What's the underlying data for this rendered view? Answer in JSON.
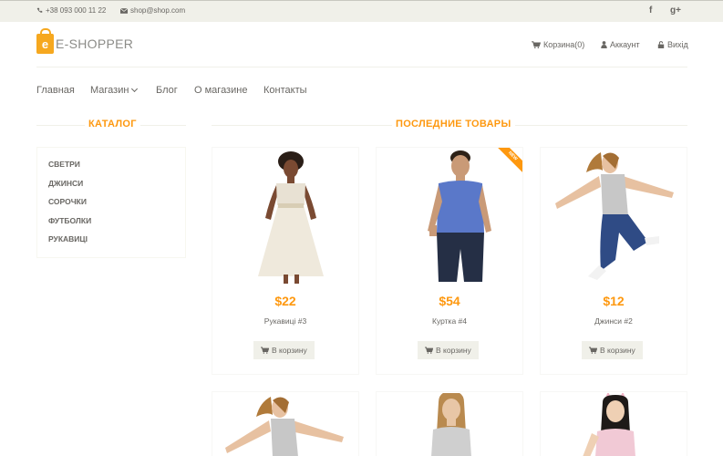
{
  "topbar": {
    "phone": "+38 093 000 11 22",
    "email": "shop@shop.com",
    "social": [
      "facebook-icon",
      "google-plus-icon"
    ],
    "facebook_glyph": "f",
    "gplus_glyph": "g+"
  },
  "logo": {
    "letter": "e",
    "brand": "E-SHOPPER"
  },
  "header_links": {
    "cart": "Корзина(0)",
    "account": "Аккаунт",
    "logout": "Вихід"
  },
  "nav": {
    "home": "Главная",
    "shop": "Магазин",
    "blog": "Блог",
    "about": "О магазине",
    "contacts": "Контакты"
  },
  "sidebar": {
    "title": "Каталог",
    "items": [
      "Светри",
      "Джинси",
      "Сорочки",
      "Футболки",
      "Рукавиці"
    ]
  },
  "products_section": {
    "title": "Последние товары",
    "cart_label": "В корзину",
    "new_label": "NEW",
    "items": [
      {
        "price": "$22",
        "name": "Рукавиці #3",
        "is_new": false
      },
      {
        "price": "$54",
        "name": "Куртка #4",
        "is_new": true
      },
      {
        "price": "$12",
        "name": "Джинси #2",
        "is_new": false
      }
    ]
  },
  "colors": {
    "accent": "#fe980f",
    "text": "#696763",
    "topbar_bg": "#f0f0e9",
    "button_bg": "#f0f0e9"
  }
}
